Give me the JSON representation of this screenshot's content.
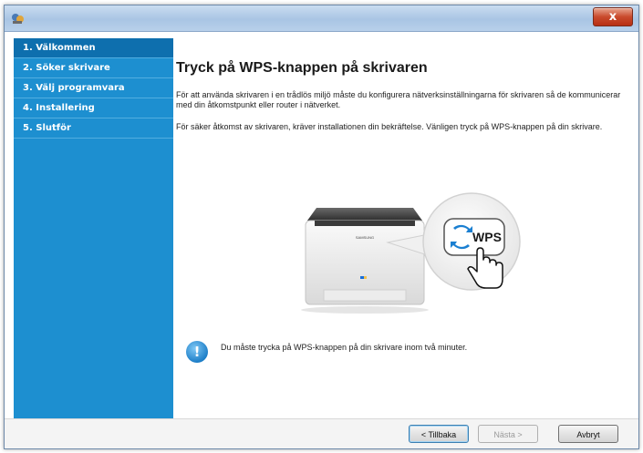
{
  "window": {
    "close_glyph": "x"
  },
  "sidebar": {
    "steps": [
      {
        "label": "1. Välkommen"
      },
      {
        "label": "2. Söker skrivare"
      },
      {
        "label": "3. Välj programvara"
      },
      {
        "label": "4. Installering"
      },
      {
        "label": "5. Slutför"
      }
    ],
    "active_index": 0
  },
  "main": {
    "title": "Tryck på WPS-knappen på skrivaren",
    "paragraph1": "För att använda skrivaren i en trådlös miljö måste du konfigurera nätverksinställningarna för skrivaren så de kommunicerar med din åtkomstpunkt eller router i nätverket.",
    "paragraph2": "För säker åtkomst av skrivaren, kräver installationen din bekräftelse. Vänligen tryck på WPS-knappen på din skrivare.",
    "wps_button_label": "WPS",
    "printer_brand": "SAMSUNG",
    "notice_text": "Du måste trycka på WPS-knappen på din skrivare inom två minuter.",
    "notice_glyph": "!"
  },
  "footer": {
    "back_label": "< Tillbaka",
    "next_label": "Nästa >",
    "cancel_label": "Avbryt"
  },
  "colors": {
    "sidebar": "#1d8fd0",
    "sidebar_active": "#0e6fae",
    "close_button": "#c94a2c",
    "wps_blue": "#1a7fd1"
  }
}
